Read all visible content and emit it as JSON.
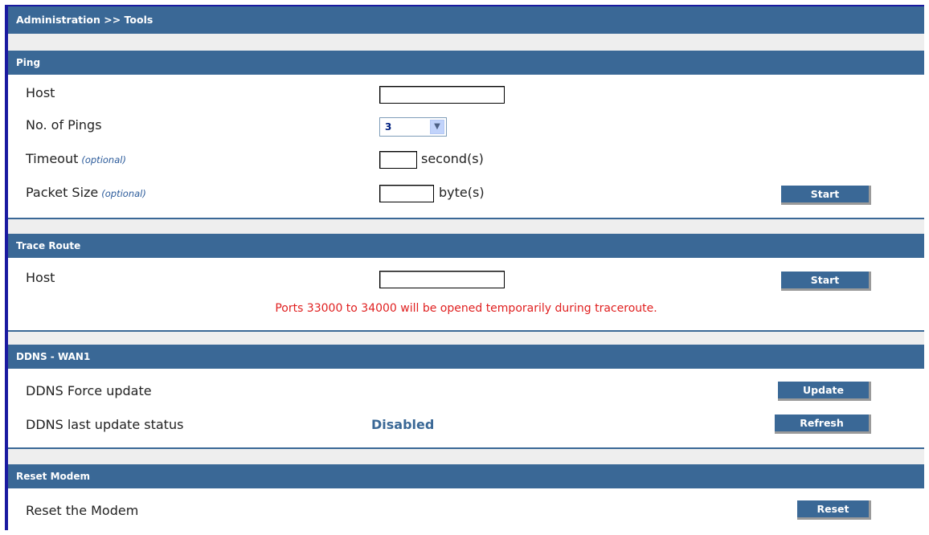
{
  "page": {
    "breadcrumb": "Administration >> Tools"
  },
  "ping": {
    "title": "Ping",
    "host_label": "Host",
    "host_value": "",
    "count_label": "No. of Pings",
    "count_value": "3",
    "timeout_label": "Timeout",
    "timeout_optional": "(optional)",
    "timeout_value": "",
    "timeout_unit": "second(s)",
    "size_label": "Packet Size",
    "size_optional": "(optional)",
    "size_value": "",
    "size_unit": "byte(s)",
    "start_label": "Start"
  },
  "trace": {
    "title": "Trace Route",
    "host_label": "Host",
    "host_value": "",
    "start_label": "Start",
    "note": "Ports 33000 to 34000 will be opened temporarily during traceroute."
  },
  "ddns": {
    "title": "DDNS - WAN1",
    "force_label": "DDNS Force update",
    "update_label": "Update",
    "status_label": "DDNS last update status",
    "status_value": "Disabled",
    "refresh_label": "Refresh"
  },
  "reset": {
    "title": "Reset Modem",
    "label": "Reset the Modem",
    "button_label": "Reset"
  },
  "colors": {
    "header": "#3a6896",
    "note": "#e02020",
    "frame_border": "#1a1aa0"
  }
}
